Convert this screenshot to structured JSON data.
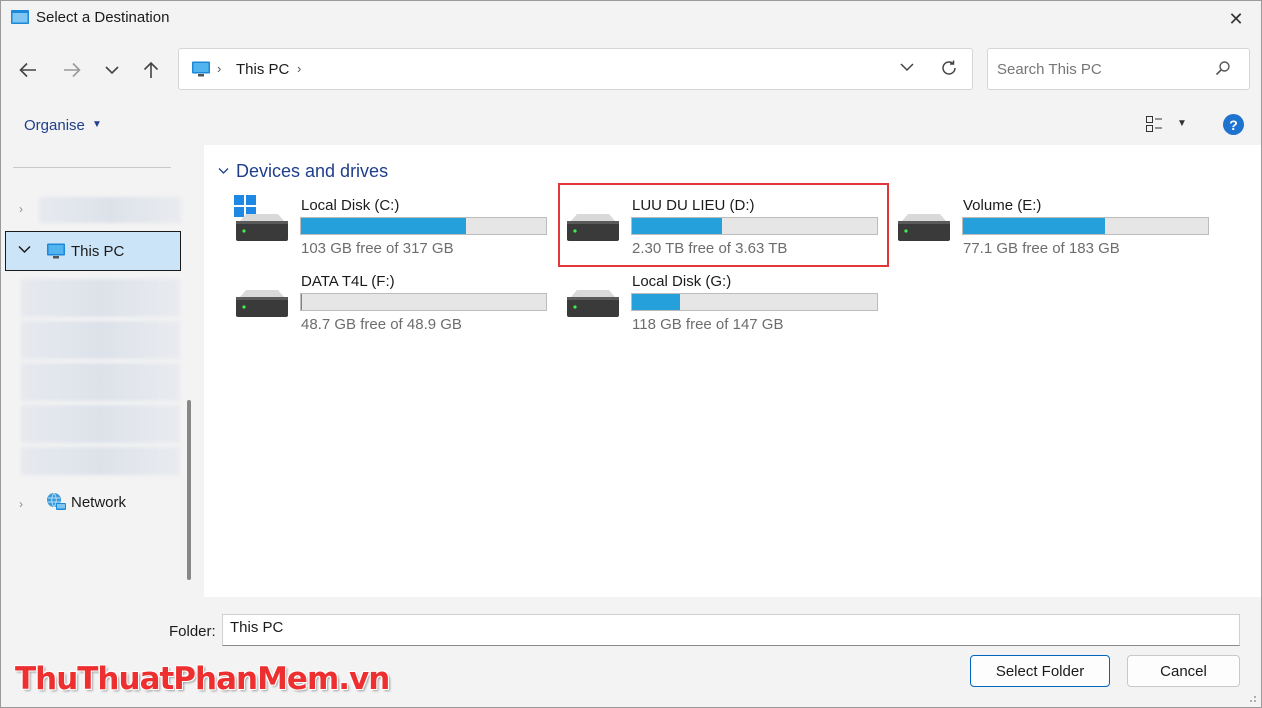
{
  "window": {
    "title": "Select a Destination",
    "close_glyph": "✕"
  },
  "address_bar": {
    "location": "This PC",
    "separator_glyph": "›"
  },
  "search": {
    "placeholder": "Search This PC"
  },
  "toolbar": {
    "organise_label": "Organise",
    "help_label": "?"
  },
  "sidebar": {
    "items": [
      {
        "label": "This PC",
        "selected": true,
        "icon": "monitor-icon"
      },
      {
        "label": "Network",
        "selected": false,
        "icon": "network-icon"
      }
    ]
  },
  "main": {
    "group_title": "Devices and drives",
    "drives": [
      {
        "name": "Local Disk (C:)",
        "free": "103 GB free of 317 GB",
        "used_fraction": 0.675,
        "system": true
      },
      {
        "name": "LUU DU LIEU (D:)",
        "free": "2.30 TB free of 3.63 TB",
        "used_fraction": 0.366,
        "highlighted": true
      },
      {
        "name": "Volume (E:)",
        "free": "77.1 GB free of 183 GB",
        "used_fraction": 0.579
      },
      {
        "name": "DATA T4L (F:)",
        "free": "48.7 GB free of 48.9 GB",
        "used_fraction": 0.004
      },
      {
        "name": "Local Disk (G:)",
        "free": "118 GB free of 147 GB",
        "used_fraction": 0.197
      }
    ]
  },
  "footer": {
    "folder_label": "Folder:",
    "folder_value": "This PC",
    "select_button": "Select Folder",
    "cancel_button": "Cancel"
  },
  "watermark": "ThuThuatPhanMem.vn",
  "colors": {
    "accent": "#1e73d1",
    "bar_fill": "#26a0da",
    "highlight": "#e0373a",
    "heading": "#1f3e8c"
  }
}
